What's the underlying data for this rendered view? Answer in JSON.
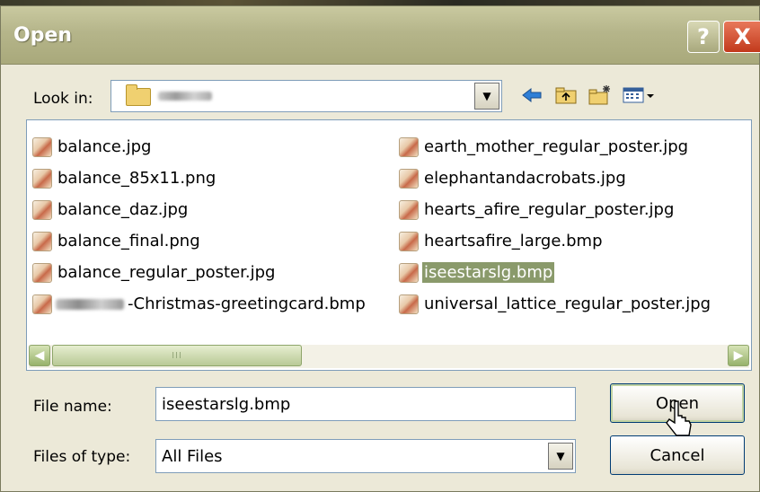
{
  "window": {
    "title": "Open",
    "help_glyph": "?",
    "close_glyph": "X"
  },
  "lookin": {
    "label": "Look in:",
    "folder_icon": "folder-icon",
    "folder_name_blurred": true
  },
  "toolbar": {
    "back_icon": "back-arrow-icon",
    "up_icon": "up-folder-icon",
    "new_folder_icon": "new-folder-icon",
    "views_icon": "views-menu-icon"
  },
  "files": {
    "column1": [
      {
        "name": "balance.jpg"
      },
      {
        "name": "balance_85x11.png"
      },
      {
        "name": "balance_daz.jpg"
      },
      {
        "name": "balance_final.png"
      },
      {
        "name": "balance_regular_poster.jpg"
      },
      {
        "name": "-Christmas-greetingcard.bmp",
        "blurred_prefix": true
      }
    ],
    "column2": [
      {
        "name": "earth_mother_regular_poster.jpg"
      },
      {
        "name": "elephantandacrobats.jpg"
      },
      {
        "name": "hearts_afire_regular_poster.jpg"
      },
      {
        "name": "heartsafire_large.bmp"
      },
      {
        "name": "iseestarslg.bmp",
        "selected": true
      },
      {
        "name": "universal_lattice_regular_poster.jpg"
      }
    ]
  },
  "scrollbar": {
    "thumb_grip": "III"
  },
  "form": {
    "filename_label": "File name:",
    "filename_value": "iseestarslg.bmp",
    "filetype_label": "Files of type:",
    "filetype_value": "All Files"
  },
  "buttons": {
    "open": "Open",
    "cancel": "Cancel"
  },
  "colors": {
    "selection": "#8a9a6b",
    "titlebar": "#b5b58a"
  }
}
